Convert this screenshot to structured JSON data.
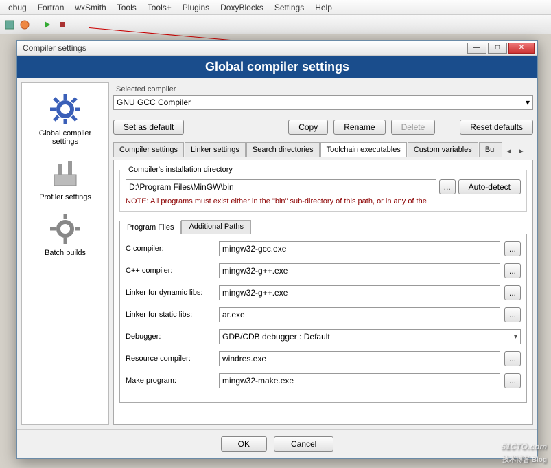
{
  "menubar": [
    "ebug",
    "Fortran",
    "wxSmith",
    "Tools",
    "Tools+",
    "Plugins",
    "DoxyBlocks",
    "Settings",
    "Help"
  ],
  "dialog": {
    "title": "Compiler settings",
    "banner": "Global compiler settings",
    "sidebar": [
      {
        "label": "Global compiler settings"
      },
      {
        "label": "Profiler settings"
      },
      {
        "label": "Batch builds"
      }
    ],
    "selected_compiler_label": "Selected compiler",
    "selected_compiler_value": "GNU GCC Compiler",
    "buttons": {
      "set_default": "Set as default",
      "copy": "Copy",
      "rename": "Rename",
      "delete": "Delete",
      "reset": "Reset defaults"
    },
    "tabs": [
      "Compiler settings",
      "Linker settings",
      "Search directories",
      "Toolchain executables",
      "Custom variables",
      "Bui"
    ],
    "active_tab": 3,
    "install": {
      "legend": "Compiler's installation directory",
      "path": "D:\\Program Files\\MinGW\\bin",
      "browse": "...",
      "autodetect": "Auto-detect",
      "note": "NOTE: All programs must exist either in the \"bin\" sub-directory of this path, or in any of the"
    },
    "subtabs": [
      "Program Files",
      "Additional Paths"
    ],
    "fields": {
      "c_compiler": {
        "label": "C compiler:",
        "value": "mingw32-gcc.exe"
      },
      "cpp_compiler": {
        "label": "C++ compiler:",
        "value": "mingw32-g++.exe"
      },
      "linker_dynamic": {
        "label": "Linker for dynamic libs:",
        "value": "mingw32-g++.exe"
      },
      "linker_static": {
        "label": "Linker for static libs:",
        "value": "ar.exe"
      },
      "debugger": {
        "label": "Debugger:",
        "value": "GDB/CDB debugger : Default"
      },
      "resource": {
        "label": "Resource compiler:",
        "value": "windres.exe"
      },
      "make": {
        "label": "Make program:",
        "value": "mingw32-make.exe"
      }
    },
    "footer": {
      "ok": "OK",
      "cancel": "Cancel"
    }
  },
  "watermark": {
    "main": "51CTO.com",
    "sub": "技术博客   Blog"
  }
}
